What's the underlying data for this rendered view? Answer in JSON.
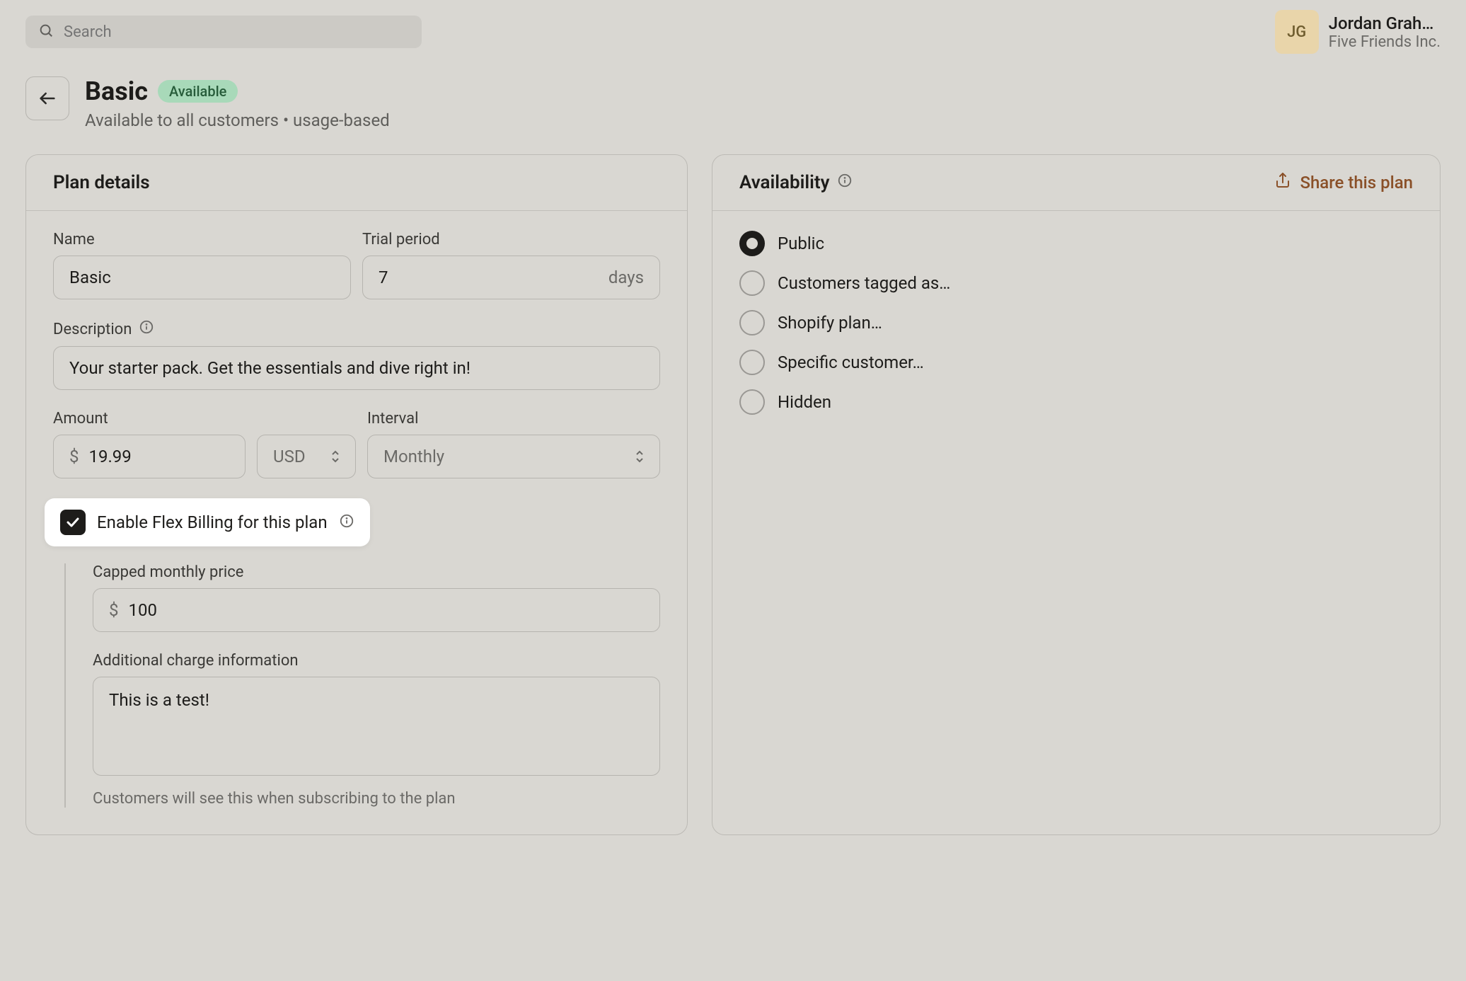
{
  "search": {
    "placeholder": "Search"
  },
  "user": {
    "initials": "JG",
    "name": "Jordan Grah…",
    "company": "Five Friends Inc."
  },
  "header": {
    "title": "Basic",
    "badge": "Available",
    "subtitle": "Available to all customers • usage-based"
  },
  "plan_details": {
    "title": "Plan details",
    "name_label": "Name",
    "name_value": "Basic",
    "trial_label": "Trial period",
    "trial_value": "7",
    "trial_unit": "days",
    "description_label": "Description",
    "description_value": "Your starter pack. Get the essentials and dive right in!",
    "amount_label": "Amount",
    "amount_value": "19.99",
    "amount_currency": "$",
    "currency_code": "USD",
    "interval_label": "Interval",
    "interval_value": "Monthly",
    "flex_label": "Enable Flex Billing for this plan",
    "capped_label": "Capped monthly price",
    "capped_currency": "$",
    "capped_value": "100",
    "additional_label": "Additional charge information",
    "additional_value": "This is a test!",
    "additional_helper": "Customers will see this when subscribing to the plan"
  },
  "availability": {
    "title": "Availability",
    "share": "Share this plan",
    "options": [
      "Public",
      "Customers tagged as…",
      "Shopify plan…",
      "Specific customer…",
      "Hidden"
    ],
    "selected": 0
  }
}
